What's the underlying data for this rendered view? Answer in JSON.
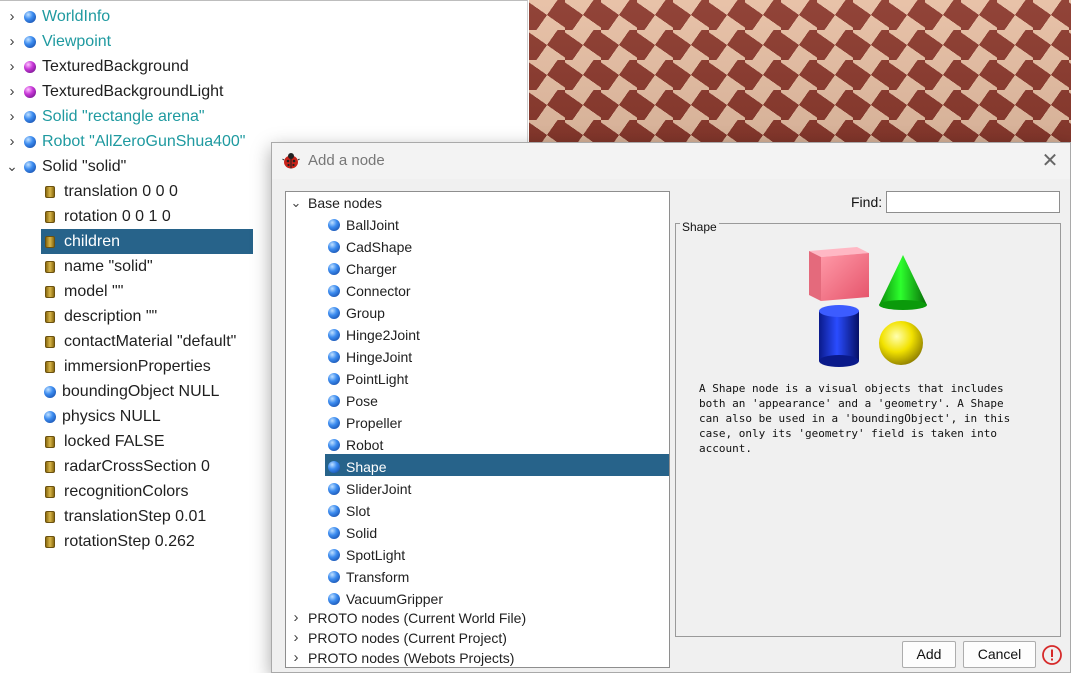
{
  "scene_tree": {
    "top_nodes": [
      {
        "label": "WorldInfo",
        "icon": "blue-sphere-icon",
        "expanded": false
      },
      {
        "label": "Viewpoint",
        "icon": "blue-sphere-icon",
        "expanded": false
      },
      {
        "label": "TexturedBackground",
        "icon": "purple-sphere-icon",
        "expanded": false
      },
      {
        "label": "TexturedBackgroundLight",
        "icon": "purple-sphere-icon",
        "expanded": false
      },
      {
        "label": "Solid \"rectangle arena\"",
        "icon": "blue-sphere-icon",
        "expanded": false
      },
      {
        "label": "Robot \"AllZeroGunShua400\"",
        "icon": "blue-sphere-icon",
        "expanded": false
      },
      {
        "label": "Solid \"solid\"",
        "icon": "blue-sphere-icon",
        "expanded": true
      }
    ],
    "fields": [
      {
        "label": "translation 0 0 0",
        "icon": "field-cylinder-icon"
      },
      {
        "label": "rotation 0 0 1 0",
        "icon": "field-cylinder-icon"
      },
      {
        "label": "children",
        "icon": "field-cylinder-icon",
        "selected": true
      },
      {
        "label": "name \"solid\"",
        "icon": "field-cylinder-icon"
      },
      {
        "label": "model \"\"",
        "icon": "field-cylinder-icon"
      },
      {
        "label": "description \"\"",
        "icon": "field-cylinder-icon"
      },
      {
        "label": "contactMaterial \"default\"",
        "icon": "field-cylinder-icon"
      },
      {
        "label": "immersionProperties",
        "icon": "field-cylinder-icon"
      },
      {
        "label": "boundingObject NULL",
        "icon": "blue-sphere-icon"
      },
      {
        "label": "physics NULL",
        "icon": "blue-sphere-icon"
      },
      {
        "label": "locked FALSE",
        "icon": "field-cylinder-icon"
      },
      {
        "label": "radarCrossSection 0",
        "icon": "field-cylinder-icon"
      },
      {
        "label": "recognitionColors",
        "icon": "field-cylinder-icon"
      },
      {
        "label": "translationStep 0.01",
        "icon": "field-cylinder-icon"
      },
      {
        "label": "rotationStep 0.262",
        "icon": "field-cylinder-icon"
      }
    ]
  },
  "dialog": {
    "title": "Add a node",
    "close_glyph": "✕",
    "find_label": "Find:",
    "find_value": "",
    "node_list": {
      "base_group": "Base nodes",
      "base_nodes": [
        "BallJoint",
        "CadShape",
        "Charger",
        "Connector",
        "Group",
        "Hinge2Joint",
        "HingeJoint",
        "PointLight",
        "Pose",
        "Propeller",
        "Robot",
        "Shape",
        "SliderJoint",
        "Slot",
        "Solid",
        "SpotLight",
        "Transform",
        "VacuumGripper"
      ],
      "selected": "Shape",
      "proto_groups": [
        "PROTO nodes (Current World File)",
        "PROTO nodes (Current Project)",
        "PROTO nodes (Webots Projects)"
      ]
    },
    "preview": {
      "title": "Shape",
      "description": "A Shape node is a visual objects that includes\nboth an 'appearance' and a 'geometry'. A Shape\ncan also be used in a 'boundingObject', in this\ncase, only its 'geometry' field is taken into\naccount."
    },
    "buttons": {
      "add": "Add",
      "cancel": "Cancel"
    }
  },
  "colors": {
    "selection": "#27638a",
    "top_node_text": "#1f9aa0",
    "warning": "#d62a2a"
  }
}
